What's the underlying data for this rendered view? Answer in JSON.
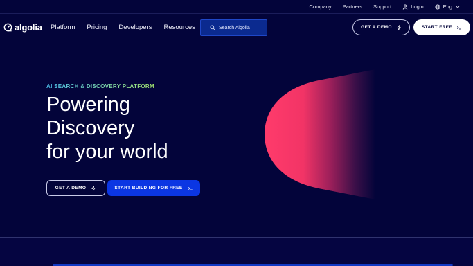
{
  "utility": {
    "company": "Company",
    "partners": "Partners",
    "support": "Support",
    "login": "Login",
    "language": "Eng"
  },
  "nav": {
    "logo_text": "algolia",
    "links": [
      "Platform",
      "Pricing",
      "Developers",
      "Resources"
    ],
    "search_placeholder": "Search Algolia",
    "demo_label": "GET A DEMO",
    "start_label": "START FREE"
  },
  "hero": {
    "eyebrow": "AI SEARCH & DISCOVERY PLATFORM",
    "title_lines": [
      "Powering",
      "Discovery",
      "for your world"
    ],
    "demo_label": "GET A DEMO",
    "start_label": "START BUILDING FOR FREE"
  },
  "colors": {
    "background": "#03043a",
    "accent_blue": "#0b36e3",
    "graphic_pink": "#ff3b6b"
  },
  "icons": [
    "algolia-logo-icon",
    "user-icon",
    "globe-icon",
    "chevron-down-icon",
    "search-icon",
    "lightning-icon",
    "terminal-icon"
  ]
}
